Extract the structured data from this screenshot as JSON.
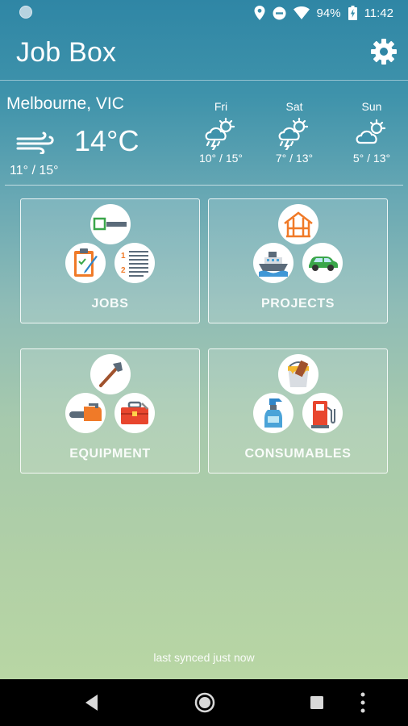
{
  "status_bar": {
    "battery": "94%",
    "time": "11:42",
    "icons": [
      "notification-dot-icon",
      "location-icon",
      "do-not-disturb-icon",
      "wifi-icon",
      "battery-charging-icon"
    ]
  },
  "app_bar": {
    "title": "Job Box",
    "settings_icon": "gear-icon"
  },
  "weather": {
    "location": "Melbourne, VIC",
    "current_temp": "14°C",
    "current_icon": "wind-icon",
    "today_range": "11° / 15°",
    "forecast": [
      {
        "day": "Fri",
        "range": "10° / 15°",
        "icon": "storm-cloud-icon"
      },
      {
        "day": "Sat",
        "range": "7° / 13°",
        "icon": "storm-cloud-icon"
      },
      {
        "day": "Sun",
        "range": "5° / 13°",
        "icon": "partly-cloudy-icon"
      }
    ]
  },
  "tiles": [
    {
      "label": "JOBS",
      "icons": [
        "checkbox-icon",
        "clipboard-icon",
        "numbered-list-icon"
      ]
    },
    {
      "label": "PROJECTS",
      "icons": [
        "house-frame-icon",
        "ship-icon",
        "car-icon"
      ]
    },
    {
      "label": "EQUIPMENT",
      "icons": [
        "axe-icon",
        "chainsaw-icon",
        "toolbox-icon"
      ]
    },
    {
      "label": "CONSUMABLES",
      "icons": [
        "paint-bucket-icon",
        "spray-bottle-icon",
        "fuel-pump-icon"
      ]
    }
  ],
  "footer": {
    "sync_text": "last synced just now"
  },
  "nav_bar": {
    "icons": [
      "back-icon",
      "home-icon",
      "recents-icon",
      "more-icon"
    ]
  },
  "colors": {
    "accent_orange": "#f07a28",
    "tile_border": "#ffffff",
    "nav_background": "#000000"
  }
}
